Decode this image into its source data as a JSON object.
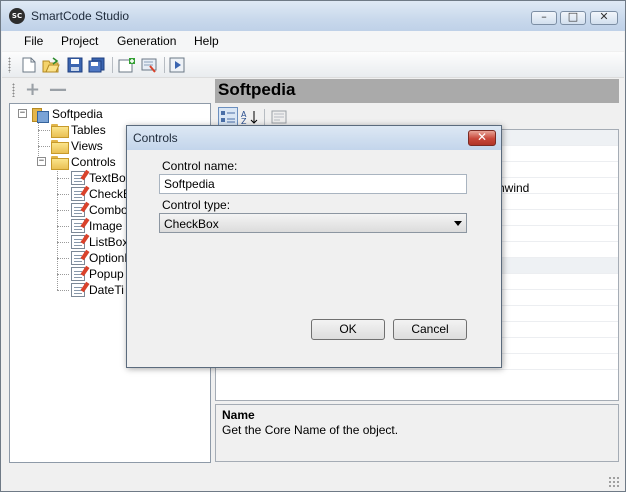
{
  "window": {
    "title": "SmartCode Studio",
    "icon_text": "SC",
    "minimize": "–",
    "maximize": "□",
    "close": "✕"
  },
  "menu": {
    "items": [
      "File",
      "Project",
      "Generation",
      "Help"
    ]
  },
  "toolbar": {
    "buttons": [
      "new-icon",
      "open-icon",
      "save-icon",
      "save-all-icon",
      "add-icon",
      "properties-icon",
      "run-icon"
    ]
  },
  "left_toolbar": {
    "add": "+",
    "remove": "—"
  },
  "tree": {
    "root": "Softpedia",
    "children": [
      {
        "label": "Tables"
      },
      {
        "label": "Views"
      },
      {
        "label": "Controls",
        "children": [
          "TextBox",
          "CheckB",
          "Combo",
          "Image",
          "ListBox",
          "OptionB",
          "Popup",
          "DateTi"
        ]
      }
    ],
    "root_expander": "−",
    "controls_expander": "−"
  },
  "right_pane": {
    "header": "Softpedia",
    "partial_text": "hwind",
    "description_title": "Name",
    "description_text": "Get the Core Name of the object."
  },
  "dialog": {
    "title": "Controls",
    "close": "✕",
    "control_name_label": "Control name:",
    "control_name_value": "Softpedia",
    "control_type_label": "Control type:",
    "control_type_value": "CheckBox",
    "ok_label": "OK",
    "cancel_label": "Cancel"
  },
  "colors": {
    "header_bg": "#aaaaaa",
    "close_button": "#c8473a",
    "titlebar": "#c9d9ec"
  }
}
